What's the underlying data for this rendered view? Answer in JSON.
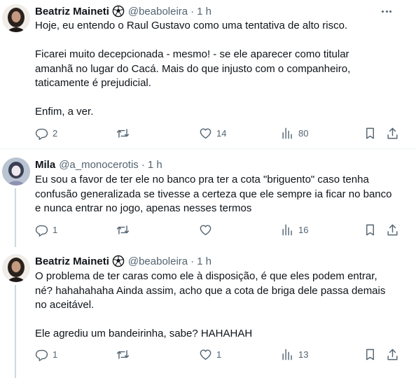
{
  "tweets": [
    {
      "author": "Beatriz Maineti",
      "badge": "soccer-ball-icon",
      "handle": "@beaboleira",
      "separator": "·",
      "time": "1 h",
      "lines": [
        "Hoje, eu entendo o Raul Gustavo como uma tentativa de alto risco.",
        "",
        "Ficarei muito decepcionada - mesmo! - se ele aparecer como titular",
        "amanhã no lugar do Cacá. Mais do que injusto com o companheiro,",
        "taticamente é prejudicial.",
        "",
        "Enfim, a ver."
      ],
      "replies": "2",
      "retweets": "",
      "likes": "14",
      "views": "80"
    },
    {
      "author": "Mila",
      "handle": "@a_monocerotis",
      "separator": "·",
      "time": "1 h",
      "lines": [
        "Eu sou a favor de ter ele no banco pra ter a cota \"briguento\" caso tenha",
        "confusão generalizada se tivesse a certeza que ele sempre ia ficar no banco",
        "e nunca entrar no jogo, apenas nesses termos"
      ],
      "replies": "1",
      "retweets": "",
      "likes": "",
      "views": "16"
    },
    {
      "author": "Beatriz Maineti",
      "badge": "soccer-ball-icon",
      "handle": "@beaboleira",
      "separator": "·",
      "time": "1 h",
      "lines": [
        "O problema de ter caras como ele à disposição, é que eles podem entrar,",
        "né? hahahahaha Ainda assim, acho que a cota de briga dele passa demais",
        "no aceitável.",
        "",
        "Ele agrediu um bandeirinha, sabe? HAHAHAH"
      ],
      "replies": "1",
      "retweets": "",
      "likes": "1",
      "views": "13"
    }
  ],
  "icons": {
    "reply": "reply-icon",
    "retweet": "retweet-icon",
    "like": "heart-icon",
    "views": "views-icon",
    "bookmark": "bookmark-icon",
    "share": "share-icon",
    "more": "more-icon"
  },
  "colors": {
    "text": "#0f1419",
    "secondary": "#536471",
    "divider": "#eff3f4",
    "thread_line": "#cfd9de"
  }
}
